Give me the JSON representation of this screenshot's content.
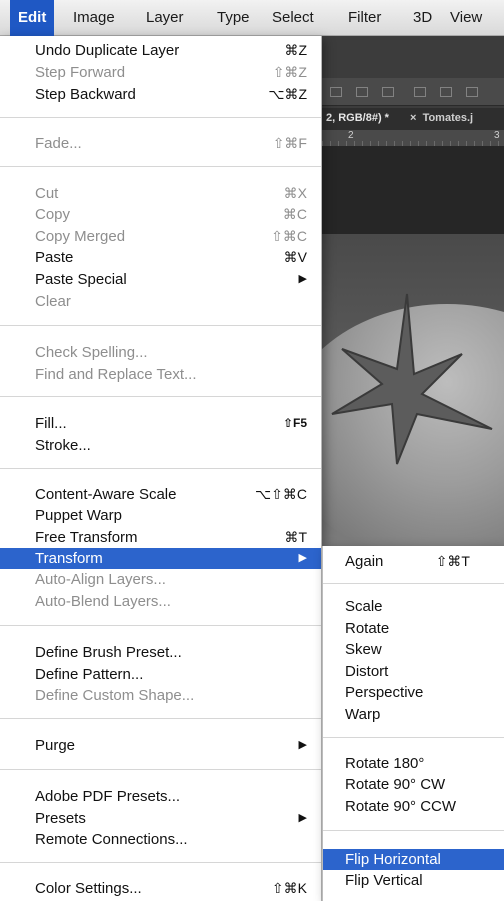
{
  "menubar": {
    "items": [
      "Edit",
      "Image",
      "Layer",
      "Type",
      "Select",
      "Filter",
      "3D",
      "View"
    ]
  },
  "background": {
    "tab_doc": "2, RGB/8#) *",
    "tab_close": "×",
    "tab_next": "Tomates.j",
    "ruler_marks": [
      "2",
      "3"
    ]
  },
  "edit_menu": {
    "items": [
      {
        "label": "Undo Duplicate Layer",
        "shortcut": "⌘Z",
        "enabled": true
      },
      {
        "label": "Step Forward",
        "shortcut": "⇧⌘Z",
        "enabled": false
      },
      {
        "label": "Step Backward",
        "shortcut": "⌥⌘Z",
        "enabled": true
      },
      {
        "label": "Fade...",
        "shortcut": "⇧⌘F",
        "enabled": false
      },
      {
        "label": "Cut",
        "shortcut": "⌘X",
        "enabled": false
      },
      {
        "label": "Copy",
        "shortcut": "⌘C",
        "enabled": false
      },
      {
        "label": "Copy Merged",
        "shortcut": "⇧⌘C",
        "enabled": false
      },
      {
        "label": "Paste",
        "shortcut": "⌘V",
        "enabled": true
      },
      {
        "label": "Paste Special",
        "submenu_arrow": "▶",
        "enabled": true
      },
      {
        "label": "Clear",
        "enabled": false
      },
      {
        "label": "Check Spelling...",
        "enabled": false
      },
      {
        "label": "Find and Replace Text...",
        "enabled": false
      },
      {
        "label": "Fill...",
        "shortcut": "⇧F5",
        "enabled": true
      },
      {
        "label": "Stroke...",
        "enabled": true
      },
      {
        "label": "Content-Aware Scale",
        "shortcut": "⌥⇧⌘C",
        "enabled": true
      },
      {
        "label": "Puppet Warp",
        "enabled": true
      },
      {
        "label": "Free Transform",
        "shortcut": "⌘T",
        "enabled": true
      },
      {
        "label": "Transform",
        "submenu_arrow": "▶",
        "enabled": true,
        "selected": true
      },
      {
        "label": "Auto-Align Layers...",
        "enabled": false
      },
      {
        "label": "Auto-Blend Layers...",
        "enabled": false
      },
      {
        "label": "Define Brush Preset...",
        "enabled": true
      },
      {
        "label": "Define Pattern...",
        "enabled": true
      },
      {
        "label": "Define Custom Shape...",
        "enabled": false
      },
      {
        "label": "Purge",
        "submenu_arrow": "▶",
        "enabled": true
      },
      {
        "label": "Adobe PDF Presets...",
        "enabled": true
      },
      {
        "label": "Presets",
        "submenu_arrow": "▶",
        "enabled": true
      },
      {
        "label": "Remote Connections...",
        "enabled": true
      },
      {
        "label": "Color Settings...",
        "shortcut": "⇧⌘K",
        "enabled": true
      }
    ]
  },
  "transform_submenu": {
    "items": [
      {
        "label": "Again",
        "shortcut": "⇧⌘T"
      },
      {
        "label": "Scale"
      },
      {
        "label": "Rotate"
      },
      {
        "label": "Skew"
      },
      {
        "label": "Distort"
      },
      {
        "label": "Perspective"
      },
      {
        "label": "Warp"
      },
      {
        "label": "Rotate 180°"
      },
      {
        "label": "Rotate 90° CW"
      },
      {
        "label": "Rotate 90° CCW"
      },
      {
        "label": "Flip Horizontal",
        "selected": true
      },
      {
        "label": "Flip Vertical"
      }
    ]
  },
  "colors": {
    "menubar_active": "#1f58c4",
    "menu_highlight": "#2c64cc",
    "disabled_text": "#8e8e8e"
  }
}
